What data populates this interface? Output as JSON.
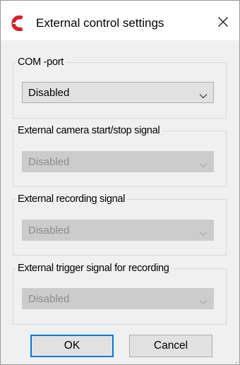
{
  "window": {
    "title": "External control settings",
    "close_label": "✕"
  },
  "groups": [
    {
      "label": "COM -port",
      "value": "Disabled",
      "enabled": true
    },
    {
      "label": "External camera start/stop signal",
      "value": "Disabled",
      "enabled": false
    },
    {
      "label": "External recording signal",
      "value": "Disabled",
      "enabled": false
    },
    {
      "label": "External trigger signal for recording",
      "value": "Disabled",
      "enabled": false
    }
  ],
  "buttons": {
    "ok_label": "OK",
    "cancel_label": "Cancel"
  },
  "icons": {
    "app": "app-logo-icon",
    "close": "close-icon",
    "dropdown": "chevron-down-icon",
    "resize": "resize-grip-icon"
  },
  "colors": {
    "app_icon": "#d2232a",
    "focus_border": "#0078d7",
    "disabled_text": "#8c8c8c"
  }
}
